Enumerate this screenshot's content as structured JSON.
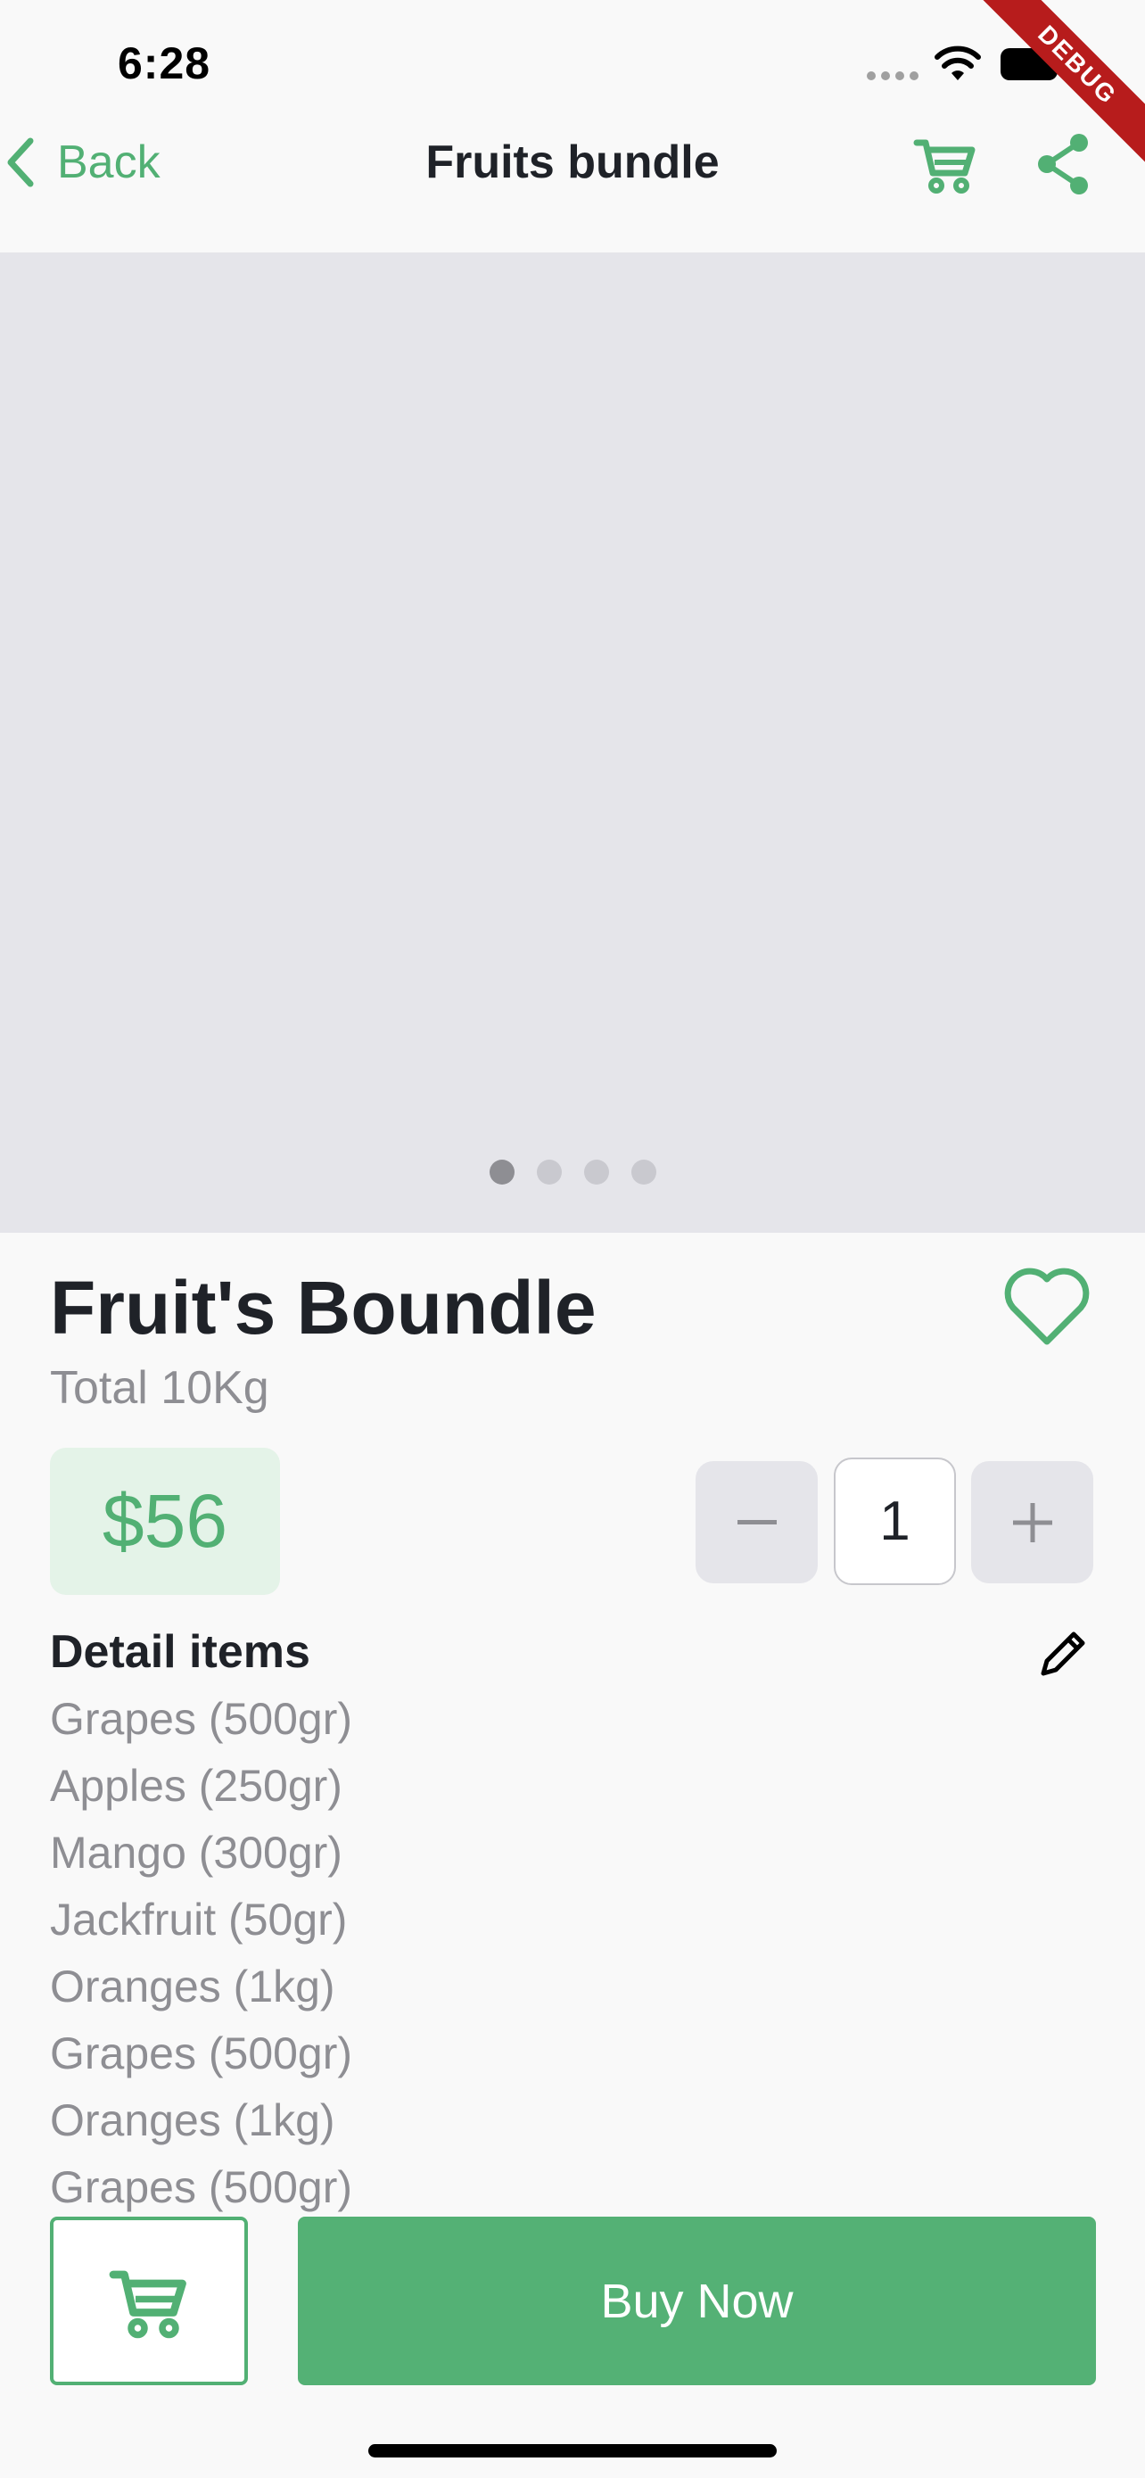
{
  "status_bar": {
    "time": "6:28"
  },
  "debug_banner": "DEBUG",
  "nav": {
    "back_label": "Back",
    "title": "Fruits bundle",
    "icons": [
      "chevron-left-icon",
      "cart-icon",
      "share-icon"
    ]
  },
  "carousel": {
    "page_count": 4,
    "active_index": 0
  },
  "product": {
    "name": "Fruit's Boundle",
    "weight": "Total 10Kg",
    "price": "$56",
    "quantity": "1"
  },
  "details": {
    "title": "Detail items",
    "items": [
      "Grapes (500gr)",
      "Apples (250gr)",
      "Mango (300gr)",
      "Jackfruit (50gr)",
      "Oranges (1kg)",
      "Grapes (500gr)",
      "Oranges (1kg)",
      "Grapes (500gr)"
    ]
  },
  "actions": {
    "buy_label": "Buy Now"
  },
  "colors": {
    "accent": "#52b074",
    "price_bg": "#e4f3e8",
    "text_primary": "#1f2228",
    "text_secondary": "#8e8e93",
    "image_placeholder": "#e5e5ea"
  }
}
